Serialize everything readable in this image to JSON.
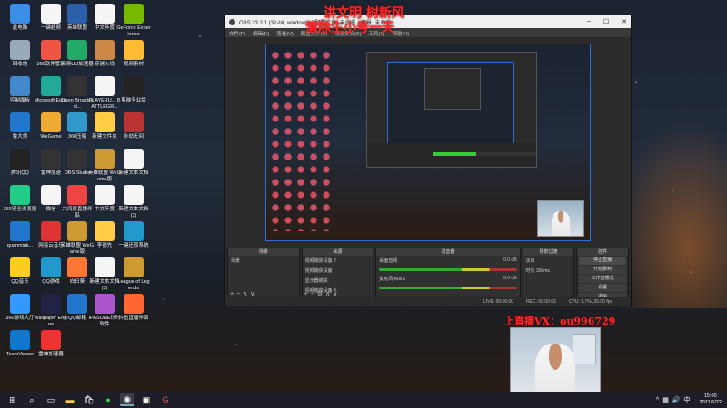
{
  "desktop": {
    "icons": [
      {
        "label": "此电脑",
        "color": "#3a8ee6"
      },
      {
        "label": "一键超频",
        "color": "#f5f5f5"
      },
      {
        "label": "英雄联盟",
        "color": "#2b5fa8"
      },
      {
        "label": "中文年度",
        "color": "#f5f5f5"
      },
      {
        "label": "GeForce Experience",
        "color": "#76b900"
      },
      {
        "label": "回收站",
        "color": "#9ab"
      },
      {
        "label": "360软件管家",
        "color": "#e54"
      },
      {
        "label": "网易UU加速器",
        "color": "#2a6"
      },
      {
        "label": "穿越火线",
        "color": "#c84"
      },
      {
        "label": "视频素材",
        "color": "#fb3"
      },
      {
        "label": "控制面板",
        "color": "#48c"
      },
      {
        "label": "Microsoft Edge",
        "color": "#2a9"
      },
      {
        "label": "Open Broadcast...",
        "color": "#333"
      },
      {
        "label": "PLAYERU... BATTLEGR...",
        "color": "#f5f5f5"
      },
      {
        "label": "剪映专业版",
        "color": "#222"
      },
      {
        "label": "鲁大师",
        "color": "#27c"
      },
      {
        "label": "WeGame",
        "color": "#ea3"
      },
      {
        "label": "360压缩",
        "color": "#39c"
      },
      {
        "label": "新建文件夹",
        "color": "#fc4"
      },
      {
        "label": "永劫无间",
        "color": "#b33"
      },
      {
        "label": "腾讯QQ",
        "color": "#222"
      },
      {
        "label": "雷神加速",
        "color": "#333"
      },
      {
        "label": "OBS Studio",
        "color": "#333"
      },
      {
        "label": "英雄联盟 WeGame版",
        "color": "#c93"
      },
      {
        "label": "新建文本文档",
        "color": "#f5f5f5"
      },
      {
        "label": "360安全浏览器",
        "color": "#2c8"
      },
      {
        "label": "微信",
        "color": "#f5f5f5"
      },
      {
        "label": "六间房直播伴侣",
        "color": "#e44"
      },
      {
        "label": "中文年度",
        "color": "#f5f5f5"
      },
      {
        "label": "新建文本文档 (2)",
        "color": "#f5f5f5"
      },
      {
        "label": "quanmink...",
        "color": "#27c"
      },
      {
        "label": "网易云音乐",
        "color": "#d33"
      },
      {
        "label": "英雄联盟 WeGame版",
        "color": "#c93"
      },
      {
        "label": "李德先",
        "color": "#fc4"
      },
      {
        "label": "一键还原系统",
        "color": "#29c"
      },
      {
        "label": "QQ音乐",
        "color": "#fc2"
      },
      {
        "label": "QQ游戏",
        "color": "#29c"
      },
      {
        "label": "向日葵",
        "color": "#f73"
      },
      {
        "label": "新建文本文档 (3)",
        "color": "#f5f5f5"
      },
      {
        "label": "League of Legends",
        "color": "#c93"
      },
      {
        "label": "360游戏大厅",
        "color": "#39f"
      },
      {
        "label": "Wallpaper Engine",
        "color": "#224"
      },
      {
        "label": "QQ邮箱",
        "color": "#27c"
      },
      {
        "label": "IPASONE计时软件",
        "color": "#a5c"
      },
      {
        "label": "斗鱼直播伴侣",
        "color": "#f63"
      },
      {
        "label": "TeamViewer",
        "color": "#17c"
      },
      {
        "label": "雷神加速器",
        "color": "#e33"
      }
    ]
  },
  "obs": {
    "title": "OBS 23.2.1 (32-bit, windows) - 配置文件: 未命名 - 场景: 未命名",
    "menu": [
      "文件(F)",
      "编辑(E)",
      "查看(V)",
      "配置文件(P)",
      "场景集合(S)",
      "工具(T)",
      "帮助(H)"
    ],
    "docks": {
      "scenes": {
        "title": "场景",
        "items": [
          "场景"
        ]
      },
      "sources": {
        "title": "来源",
        "items": [
          "视频捕获设备 2",
          "视频捕获设备",
          "显示器捕获",
          "视频捕获设备 3"
        ]
      },
      "mixer": {
        "title": "混音器",
        "channels": [
          {
            "name": "桌面音频",
            "db": "0.0 dB"
          },
          {
            "name": "麦克风/Aux 2",
            "db": "0.0 dB"
          }
        ]
      },
      "transitions": {
        "title": "场景过渡",
        "type": "淡出",
        "duration_label": "时长",
        "duration": "300ms"
      },
      "controls": {
        "title": "控件",
        "buttons": [
          "停止直播",
          "开始录制",
          "工作室模式",
          "设置",
          "退出"
        ]
      }
    },
    "status": {
      "live": "LIVE: 00:00:00",
      "rec": "REC: 00:00:00",
      "cpu": "CPU: 1.7%, 30.00 fps"
    }
  },
  "overlay": {
    "line1": "讲文明 树新风",
    "line2": "清除生小号一天",
    "contact": "上直播VX：ou996729"
  },
  "taskbar": {
    "time": "15:00",
    "date": "2021/6/22",
    "lang": "中"
  }
}
